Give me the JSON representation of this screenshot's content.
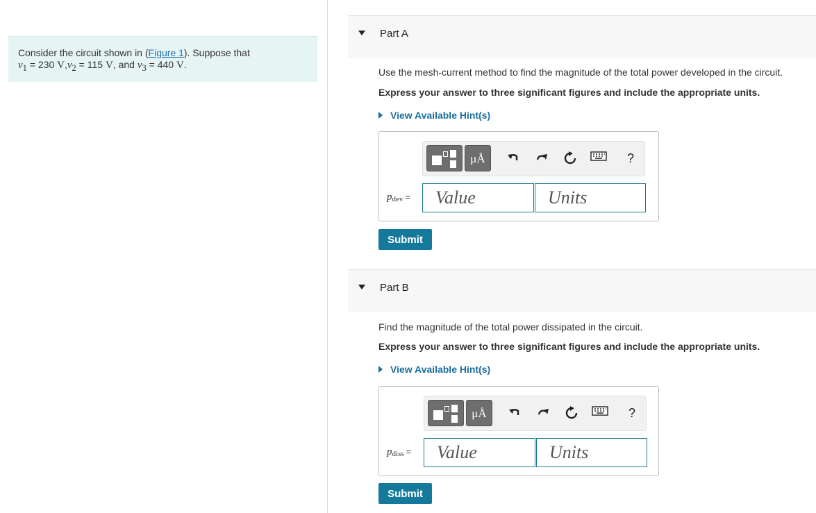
{
  "problem": {
    "intro": "Consider the circuit shown in (",
    "figure_link": "Figure 1",
    "intro_end": "). Suppose that",
    "v1_sym": "v",
    "v1_sub": "1",
    "v1_val": " = 230 ",
    "v1_unit": "V",
    "sep1": ",",
    "v2_sym": "v",
    "v2_sub": "2",
    "v2_val": " = 115 ",
    "v2_unit": "V",
    "sep2": ", and ",
    "v3_sym": "v",
    "v3_sub": "3",
    "v3_val": " = 440 ",
    "v3_unit": "V",
    "end": "."
  },
  "parts": [
    {
      "title": "Part A",
      "prompt": "Use the mesh-current method to find the magnitude of the total power developed in the circuit.",
      "instruction": "Express your answer to three significant figures and include the appropriate units.",
      "hint": "View Available Hint(s)",
      "var_symbol": "p",
      "var_sub": "dev",
      "equals": "=",
      "value_placeholder": "Value",
      "units_placeholder": "Units",
      "submit": "Submit"
    },
    {
      "title": "Part B",
      "prompt": "Find the magnitude of the total power dissipated in the circuit.",
      "instruction": "Express your answer to three significant figures and include the appropriate units.",
      "hint": "View Available Hint(s)",
      "var_symbol": "p",
      "var_sub": "diss",
      "equals": "=",
      "value_placeholder": "Value",
      "units_placeholder": "Units",
      "submit": "Submit"
    }
  ],
  "toolbar": {
    "units_glyph": "μÅ",
    "help_glyph": "?",
    "icons": [
      "templates-icon",
      "units-icon",
      "undo-icon",
      "redo-icon",
      "reset-icon",
      "keyboard-icon",
      "help-icon"
    ]
  },
  "colors": {
    "problem_bg": "#e6f4f4",
    "link": "#1c75bc",
    "hint": "#1a6e9e",
    "submit_bg": "#15799c",
    "field_border": "#1a7c8f"
  }
}
